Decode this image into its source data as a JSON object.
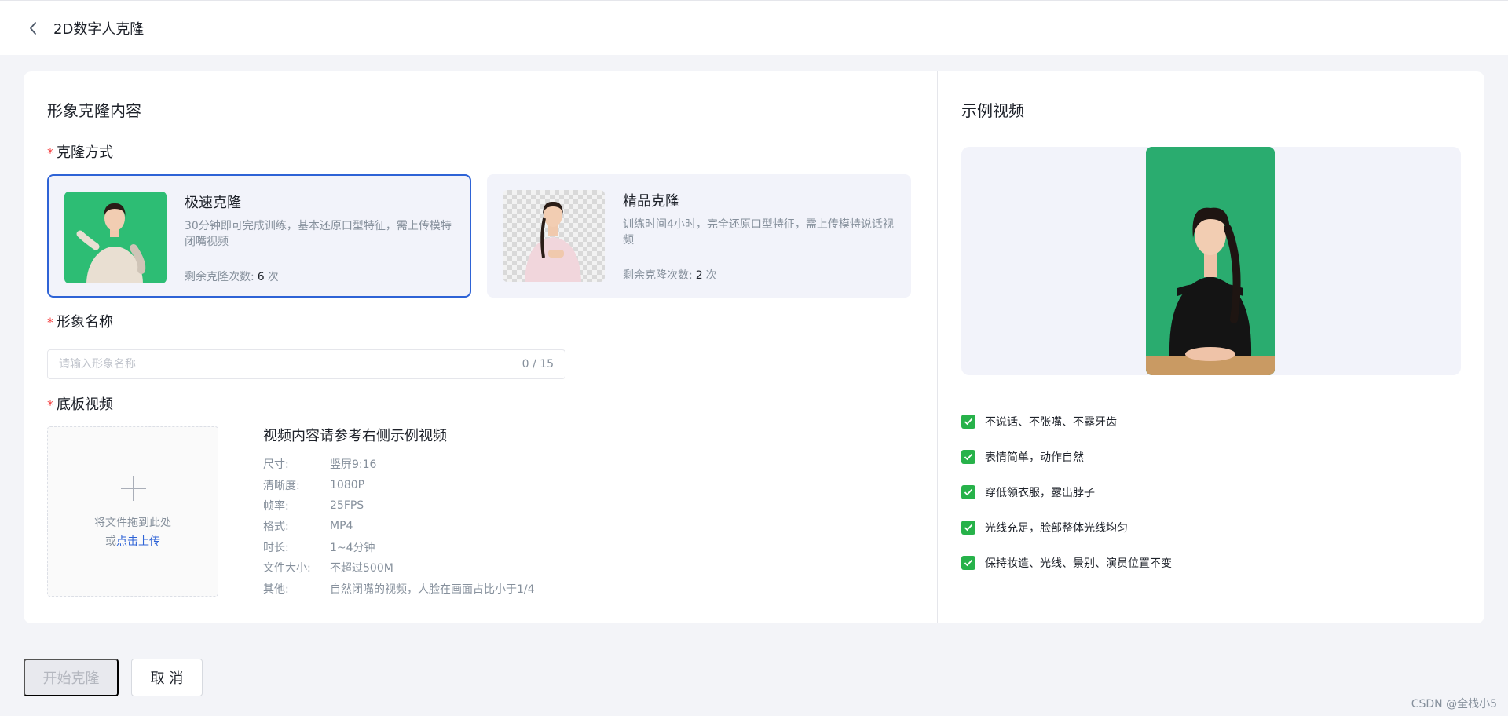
{
  "header": {
    "back_icon": "chevron-left-icon",
    "title": "2D数字人克隆"
  },
  "left_panel": {
    "section_title": "形象克隆内容",
    "clone_method": {
      "label": "克隆方式",
      "required_mark": "*",
      "options": [
        {
          "title": "极速克隆",
          "desc": "30分钟即可完成训练，基本还原口型特征，需上传模特闭嘴视频",
          "count_label": "剩余克隆次数:",
          "count": "6",
          "count_unit": "次",
          "selected": true
        },
        {
          "title": "精品克隆",
          "desc": "训练时间4小时，完全还原口型特征，需上传模特说话视频",
          "count_label": "剩余克隆次数:",
          "count": "2",
          "count_unit": "次",
          "selected": false
        }
      ]
    },
    "avatar_name": {
      "label": "形象名称",
      "required_mark": "*",
      "placeholder": "请输入形象名称",
      "value": "",
      "counter": "0 / 15"
    },
    "base_video": {
      "label": "底板视频",
      "required_mark": "*",
      "upload": {
        "icon": "plus-icon",
        "drag_text": "将文件拖到此处",
        "or_text": "或",
        "link_text": "点击上传"
      },
      "spec_title": "视频内容请参考右侧示例视频",
      "specs": [
        {
          "key": "尺寸:",
          "value": "竖屏9:16"
        },
        {
          "key": "清晰度:",
          "value": "1080P"
        },
        {
          "key": "帧率:",
          "value": "25FPS"
        },
        {
          "key": "格式:",
          "value": "MP4"
        },
        {
          "key": "时长:",
          "value": "1~4分钟"
        },
        {
          "key": "文件大小:",
          "value": "不超过500M"
        },
        {
          "key": "其他:",
          "value": "自然闭嘴的视频，人脸在画面占比小于1/4"
        }
      ]
    }
  },
  "right_panel": {
    "section_title": "示例视频",
    "rules": [
      "不说话、不张嘴、不露牙齿",
      "表情简单，动作自然",
      "穿低领衣服，露出脖子",
      "光线充足，脸部整体光线均匀",
      "保持妆造、光线、景别、演员位置不变"
    ]
  },
  "footer": {
    "start_label": "开始克隆",
    "cancel_label": "取 消"
  },
  "watermark": "CSDN @全栈小5",
  "colors": {
    "accent": "#2e63d6",
    "required": "#f53f3f",
    "check": "#27b24a",
    "green_screen": "#2dbd74"
  }
}
